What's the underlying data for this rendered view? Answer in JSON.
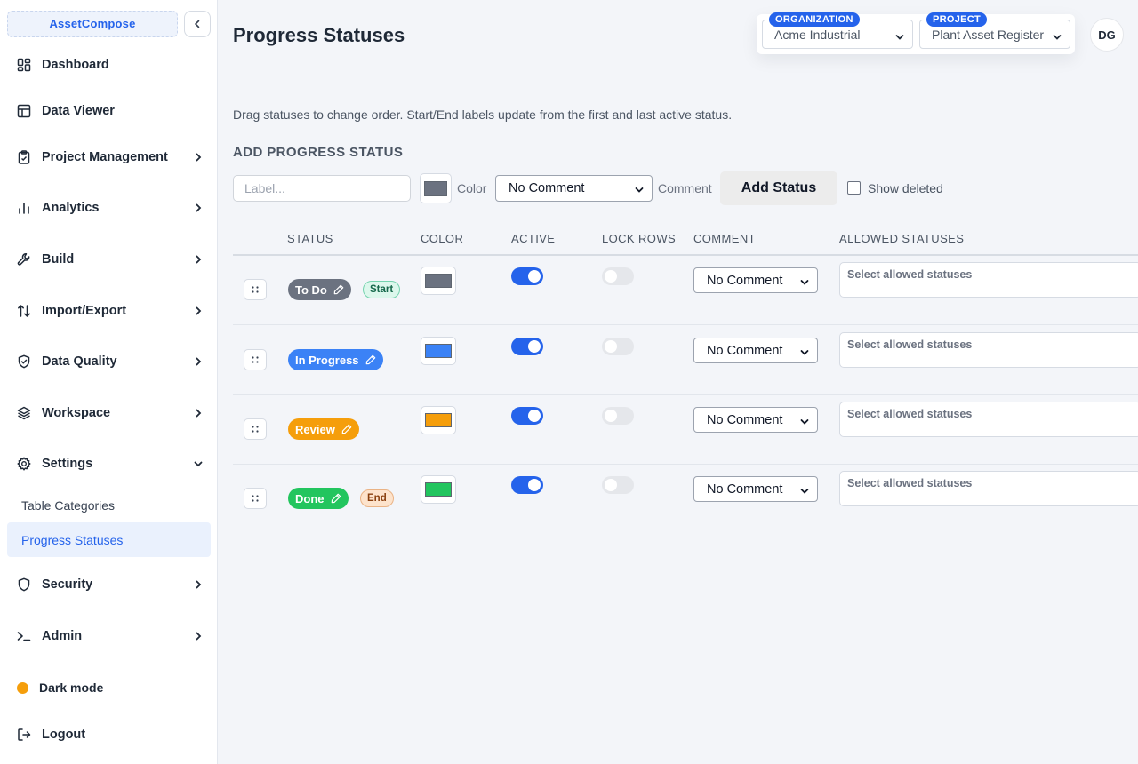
{
  "sidebar": {
    "brand": "AssetCompose",
    "items": [
      {
        "label": "Dashboard"
      },
      {
        "label": "Data Viewer"
      },
      {
        "label": "Project Management"
      },
      {
        "label": "Analytics"
      },
      {
        "label": "Build"
      },
      {
        "label": "Import/Export"
      },
      {
        "label": "Data Quality"
      },
      {
        "label": "Workspace"
      },
      {
        "label": "Settings"
      }
    ],
    "settings_sub": [
      {
        "label": "Table Categories"
      },
      {
        "label": "Progress Statuses"
      }
    ],
    "security": "Security",
    "admin": "Admin",
    "dark_mode": "Dark mode",
    "logout": "Logout"
  },
  "header": {
    "title": "Progress Statuses",
    "org_label": "ORGANIZATION",
    "org_value": "Acme Industrial",
    "project_label": "PROJECT",
    "project_value": "Plant Asset Register",
    "avatar": "DG"
  },
  "helper_text": "Drag statuses to change order. Start/End labels update from the first and last active status.",
  "add_form": {
    "section_title": "ADD PROGRESS STATUS",
    "label_placeholder": "Label...",
    "color_label": "Color",
    "color_value": "#6b7280",
    "comment_value": "No Comment",
    "comment_label": "Comment",
    "add_button": "Add Status",
    "show_deleted": "Show deleted"
  },
  "table": {
    "headers": {
      "status": "STATUS",
      "color": "COLOR",
      "active": "ACTIVE",
      "lock_rows": "LOCK ROWS",
      "comment": "COMMENT",
      "allowed": "ALLOWED STATUSES"
    },
    "rows": [
      {
        "label": "To Do",
        "color": "#6b7280",
        "tag": "Start",
        "active": true,
        "lock_rows": false,
        "comment": "No Comment",
        "allowed": "Select allowed statuses"
      },
      {
        "label": "In Progress",
        "color": "#3b82f6",
        "tag": "",
        "active": true,
        "lock_rows": false,
        "comment": "No Comment",
        "allowed": "Select allowed statuses"
      },
      {
        "label": "Review",
        "color": "#f59e0b",
        "tag": "",
        "active": true,
        "lock_rows": false,
        "comment": "No Comment",
        "allowed": "Select allowed statuses"
      },
      {
        "label": "Done",
        "color": "#22c55e",
        "tag": "End",
        "active": true,
        "lock_rows": false,
        "comment": "No Comment",
        "allowed": "Select allowed statuses"
      }
    ]
  },
  "colors": {
    "accent": "#2563eb",
    "todo": "#6b7280",
    "in_progress": "#3b82f6",
    "review": "#f59e0b",
    "done": "#22c55e",
    "dark_mode_dot": "#f59e0b"
  },
  "icons": {
    "dashboard": "dashboard-icon",
    "data_viewer": "table-icon",
    "project_management": "clipboard-icon",
    "analytics": "bar-chart-icon",
    "build": "wrench-icon",
    "import_export": "arrows-updown-icon",
    "data_quality": "shield-check-icon",
    "workspace": "layers-icon",
    "settings": "gear-icon",
    "security": "shield-icon",
    "admin": "terminal-icon",
    "logout": "logout-icon",
    "edit": "pencil-icon",
    "drag": "drag-handle-icon"
  }
}
